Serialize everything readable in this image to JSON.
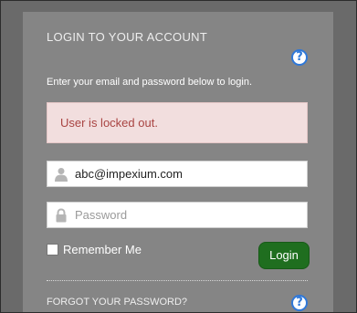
{
  "login": {
    "title": "LOGIN TO YOUR ACCOUNT",
    "instructions": "Enter your email and password below to login.",
    "error_message": "User is locked out.",
    "email": {
      "value": "abc@impexium.com",
      "icon": "user-icon"
    },
    "password": {
      "placeholder": "Password",
      "icon": "lock-icon"
    },
    "remember_label": "Remember Me",
    "remember_checked": false,
    "login_button": "Login",
    "forgot_label": "FORGOT YOUR PASSWORD?",
    "help_glyph": "?"
  },
  "colors": {
    "background": "#6a6a6a",
    "panel": "#858585",
    "error_bg": "#f2dede",
    "error_text": "#a94442",
    "login_button": "#1f6e1f",
    "help_icon": "#2f78d8"
  }
}
